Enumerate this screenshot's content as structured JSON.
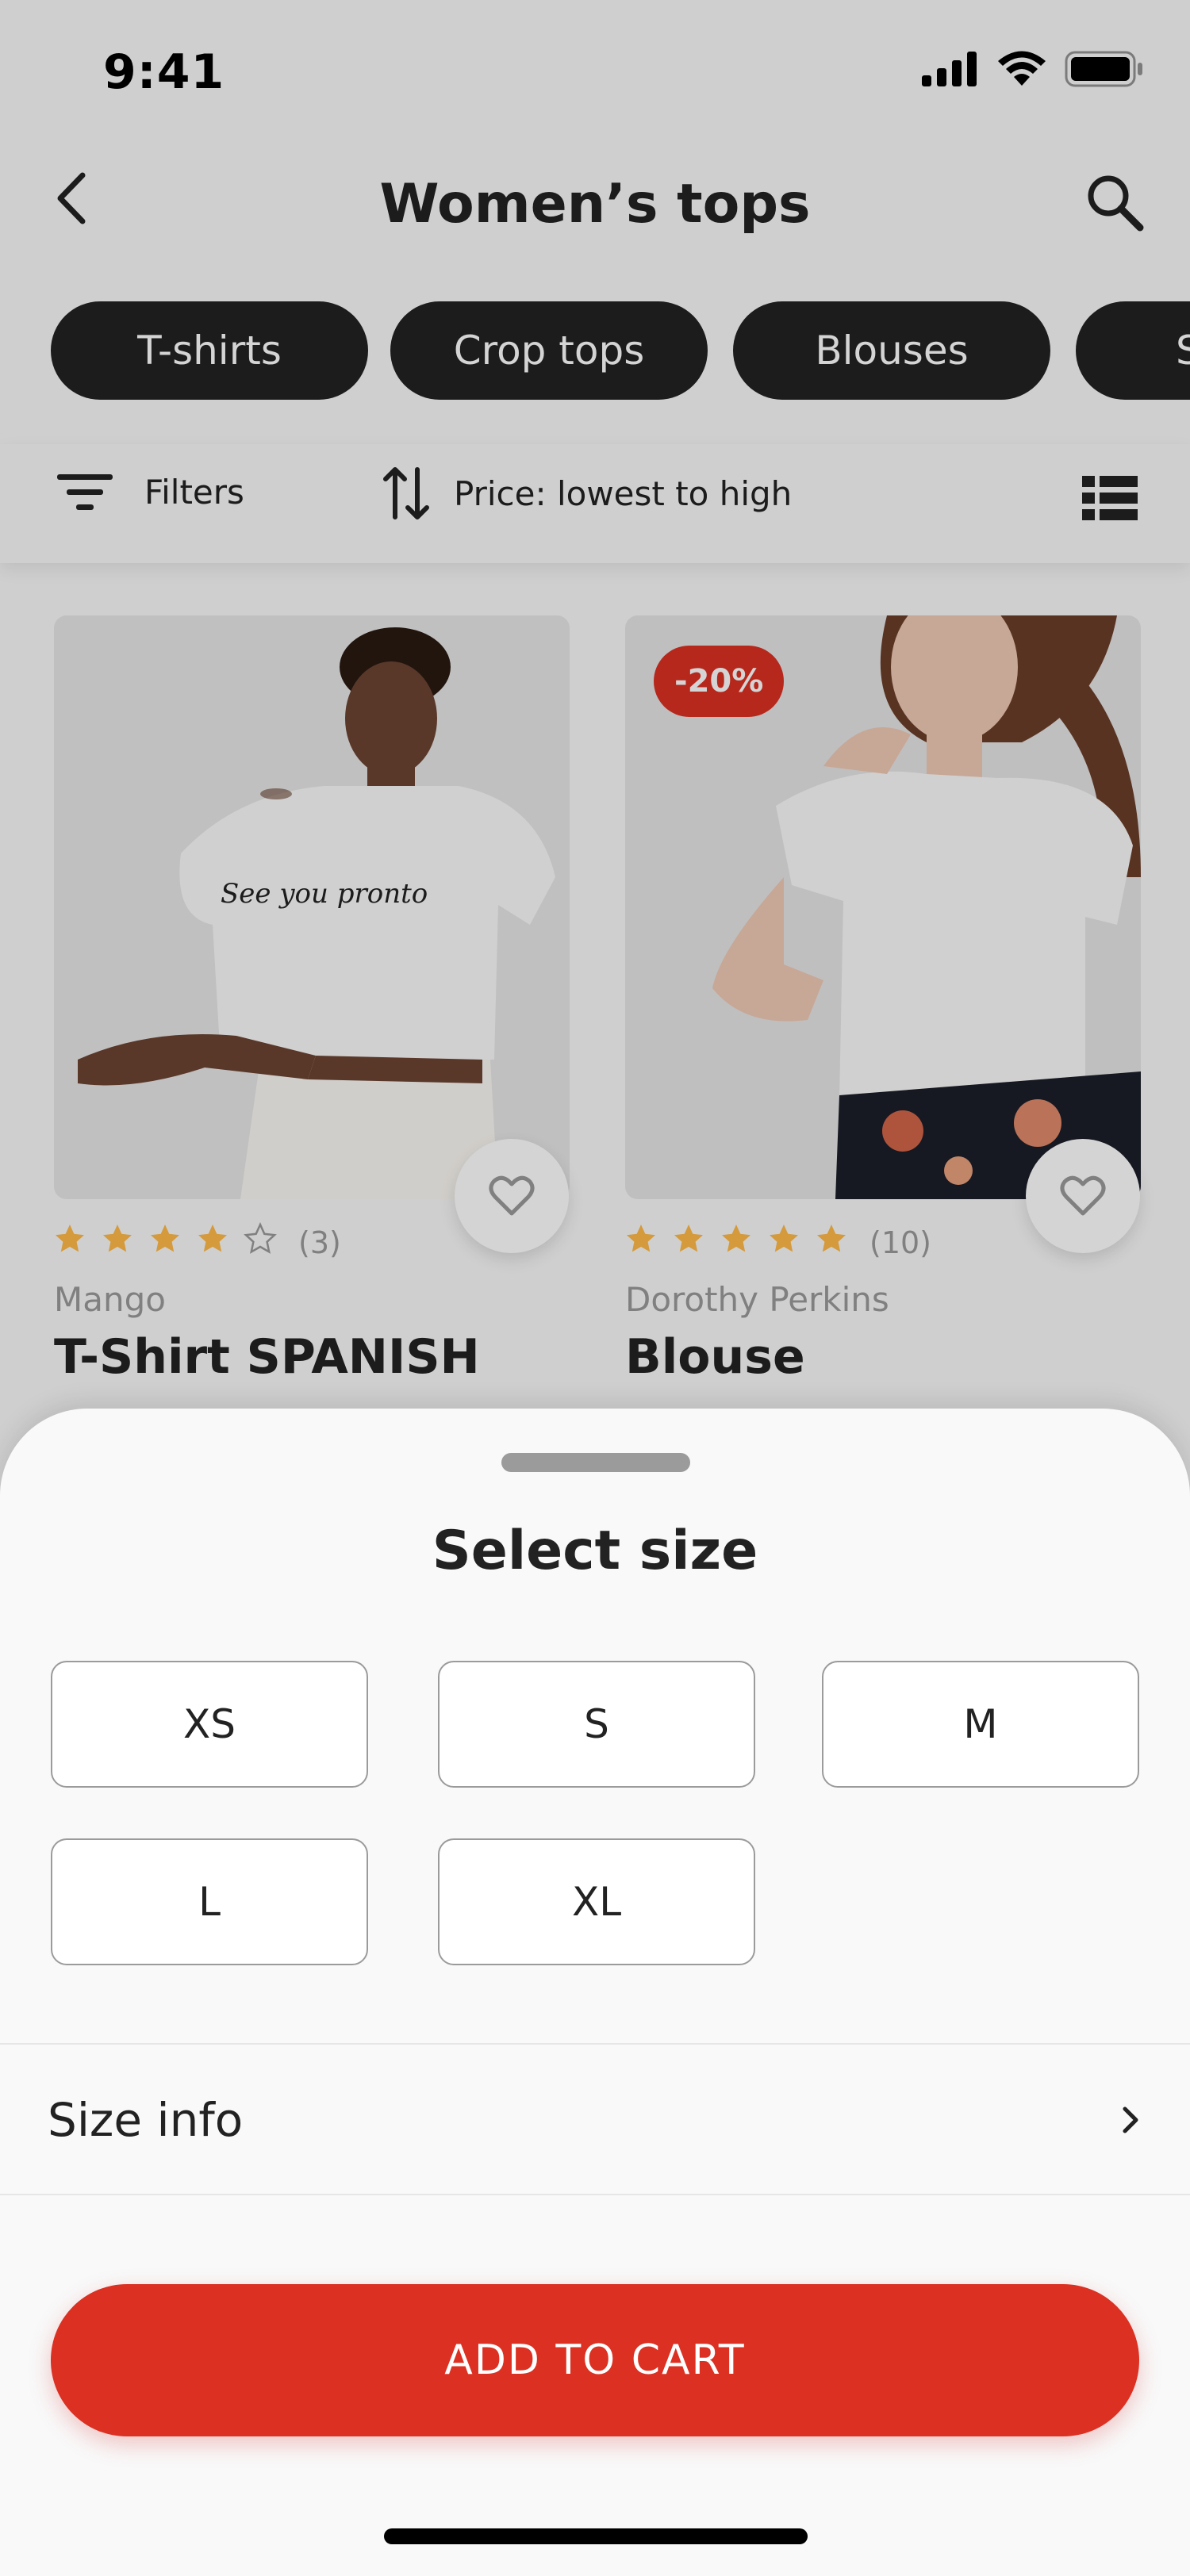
{
  "status_bar": {
    "time": "9:41",
    "icons": [
      "signal-icon",
      "wifi-icon",
      "battery-icon"
    ]
  },
  "header": {
    "title": "Women’s tops",
    "back_icon": "chevron-left-icon",
    "search_icon": "search-icon"
  },
  "categories": [
    "T-shirts",
    "Crop tops",
    "Blouses",
    "S"
  ],
  "filter_bar": {
    "filters_label": "Filters",
    "sort_label": "Price: lowest to high"
  },
  "products": [
    {
      "brand": "Mango",
      "name": "T-Shirt SPANISH",
      "rating": 4,
      "rating_max": 5,
      "reviews": "(3)",
      "badge": "",
      "image_text": "See you pronto"
    },
    {
      "brand": "Dorothy Perkins",
      "name": "Blouse",
      "rating": 5,
      "rating_max": 5,
      "reviews": "(10)",
      "badge": "-20%"
    }
  ],
  "sheet": {
    "title": "Select size",
    "sizes": [
      "XS",
      "S",
      "M",
      "L",
      "XL"
    ],
    "size_info_label": "Size info",
    "add_to_cart": "ADD TO CART"
  },
  "colors": {
    "primary": "#db3022",
    "dark": "#222222",
    "gray": "#9b9b9b",
    "star": "#ffba49",
    "background": "#f9f9f9"
  }
}
